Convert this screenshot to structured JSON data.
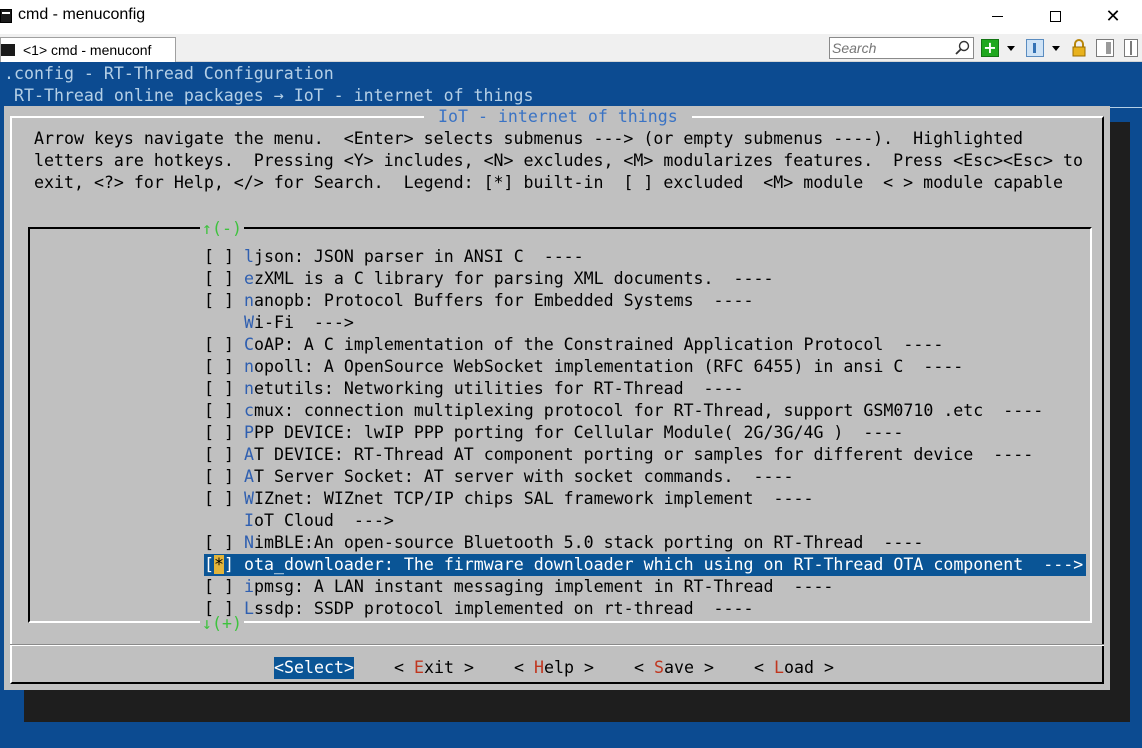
{
  "window": {
    "title": "cmd - menuconfig",
    "tab_label": "<1> cmd - menuconf",
    "search_placeholder": "Search"
  },
  "terminal": {
    "header_title": ".config - RT-Thread Configuration",
    "breadcrumb": " RT-Thread online packages → IoT - internet of things ",
    "dialog_title": " IoT - internet of things ",
    "help_lines": [
      "Arrow keys navigate the menu.  <Enter> selects submenus ---> (or empty submenus ----).  Highlighted",
      "letters are hotkeys.  Pressing <Y> includes, <N> excludes, <M> modularizes features.  Press <Esc><Esc> to",
      "exit, <?> for Help, </> for Search.  Legend: [*] built-in  [ ] excluded  <M> module  < > module capable"
    ],
    "scroll_up": "↑(-)",
    "scroll_down": "↓(+)",
    "items": [
      {
        "box": "[ ]",
        "hotkey": "l",
        "rest": "json: JSON parser in ANSI C  ----"
      },
      {
        "box": "[ ]",
        "hotkey": "e",
        "rest": "zXML is a C library for parsing XML documents.  ----"
      },
      {
        "box": "[ ]",
        "hotkey": "n",
        "rest": "anopb: Protocol Buffers for Embedded Systems  ----"
      },
      {
        "box": "   ",
        "hotkey": "W",
        "rest": "i-Fi  --->"
      },
      {
        "box": "[ ]",
        "hotkey": "C",
        "rest": "oAP: A C implementation of the Constrained Application Protocol  ----"
      },
      {
        "box": "[ ]",
        "hotkey": "n",
        "rest": "opoll: A OpenSource WebSocket implementation (RFC 6455) in ansi C  ----"
      },
      {
        "box": "[ ]",
        "hotkey": "n",
        "rest": "etutils: Networking utilities for RT-Thread  ----"
      },
      {
        "box": "[ ]",
        "hotkey": "c",
        "rest": "mux: connection multiplexing protocol for RT-Thread, support GSM0710 .etc  ----"
      },
      {
        "box": "[ ]",
        "hotkey": "P",
        "rest": "PP DEVICE: lwIP PPP porting for Cellular Module( 2G/3G/4G )  ----"
      },
      {
        "box": "[ ]",
        "hotkey": "A",
        "rest": "T DEVICE: RT-Thread AT component porting or samples for different device  ----"
      },
      {
        "box": "[ ]",
        "hotkey": "A",
        "rest": "T Server Socket: AT server with socket commands.  ----"
      },
      {
        "box": "[ ]",
        "hotkey": "W",
        "rest": "IZnet: WIZnet TCP/IP chips SAL framework implement  ----"
      },
      {
        "box": "   ",
        "hotkey": "I",
        "rest": "oT Cloud  --->"
      },
      {
        "box": "[ ]",
        "hotkey": "N",
        "rest": "imBLE:An open-source Bluetooth 5.0 stack porting on RT-Thread  ----"
      },
      {
        "box": "[*]",
        "hotkey": "o",
        "rest": "ta_downloader: The firmware downloader which using on RT-Thread OTA component  --->"
      },
      {
        "box": "[ ]",
        "hotkey": "i",
        "rest": "pmsg: A LAN instant messaging implement in RT-Thread  ----"
      },
      {
        "box": "[ ]",
        "hotkey": "L",
        "rest": "ssdp: SSDP protocol implemented on rt-thread  ----"
      }
    ],
    "selected_index": 14,
    "buttons": [
      {
        "pre": "<",
        "hotkey": "S",
        "post": "elect>",
        "active": true
      },
      {
        "pre": "< ",
        "hotkey": "E",
        "post": "xit >",
        "active": false
      },
      {
        "pre": "< ",
        "hotkey": "H",
        "post": "elp >",
        "active": false
      },
      {
        "pre": "< ",
        "hotkey": "S",
        "post": "ave >",
        "active": false
      },
      {
        "pre": "< ",
        "hotkey": "L",
        "post": "oad >",
        "active": false
      }
    ]
  },
  "colors": {
    "terminal_bg": "#0c4b91",
    "dialog_bg": "#c0c0c0",
    "highlight_bg": "#0a5596",
    "hotkey_blue": "#2f5fb0",
    "button_hotkey_red": "#c0361f",
    "scroll_green": "#3ec23e"
  }
}
